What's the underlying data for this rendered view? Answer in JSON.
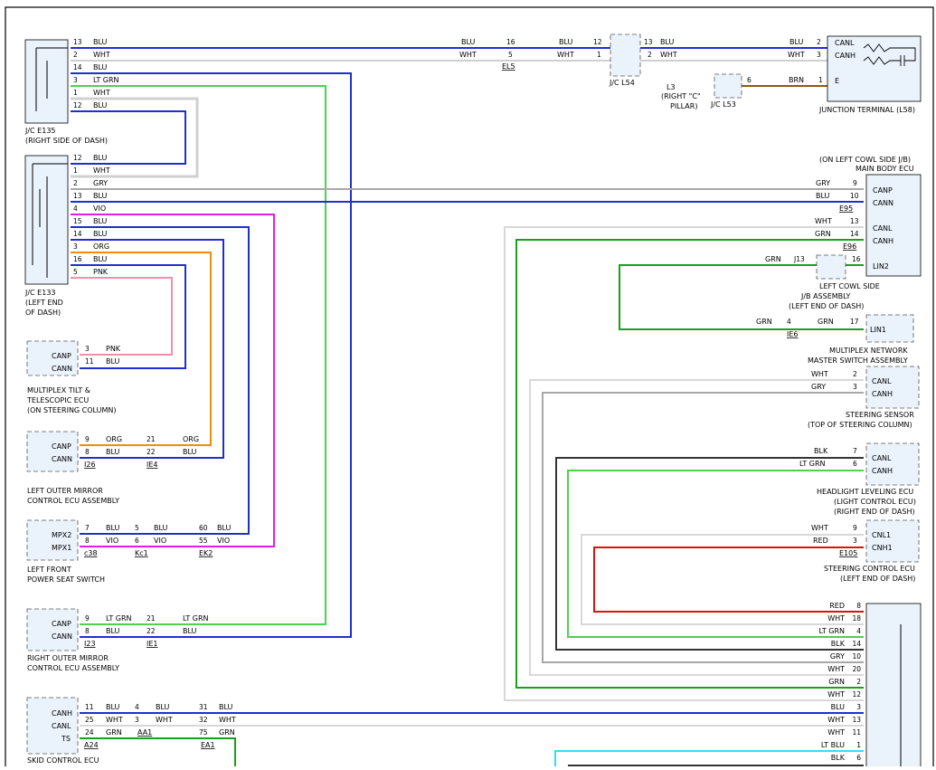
{
  "colors": {
    "BLU": "#1f2fcf",
    "WHT": "#cfcfcf",
    "LT GRN": "#4fd04f",
    "GRN": "#1aa01a",
    "GRY": "#a8a8a8",
    "VIO": "#e020e0",
    "ORG": "#f08c10",
    "PNK": "#f090a8",
    "BRN": "#8a5a10",
    "BLK": "#333333",
    "RED": "#e01010",
    "LT BLU": "#30e0f0"
  },
  "components": {
    "jc_e135": [
      "J/C E135",
      "(RIGHT SIDE OF DASH)"
    ],
    "jc_e133": [
      "J/C E133",
      "(LEFT END",
      "OF DASH)"
    ],
    "jc_l54": "J/C L54",
    "jc_l53": "J/C L53",
    "l3": [
      "L3",
      "(RIGHT \"C\"",
      "PILLAR)"
    ],
    "junction_terminal": "JUNCTION TERMINAL (L58)",
    "main_body_ecu": [
      "(ON LEFT COWL SIDE J/B)",
      "MAIN BODY ECU"
    ],
    "cowl_jb": [
      "LEFT COWL SIDE",
      "J/B ASSEMBLY",
      "(LEFT END OF DASH)"
    ],
    "multiplex_switch": [
      "MULTIPLEX NETWORK",
      "MASTER SWITCH ASSEMBLY"
    ],
    "steering_sensor": [
      "STEERING SENSOR",
      "(TOP OF STEERING COLUMN)"
    ],
    "headlight_ecu": [
      "HEADLIGHT LEVELING ECU",
      "(LIGHT CONTROL ECU)",
      "(RIGHT END OF DASH)"
    ],
    "steering_ecu": [
      "STEERING CONTROL ECU",
      "(LEFT END OF DASH)"
    ],
    "tilt_ecu": [
      "MULTIPLEX TILT &",
      "TELESCOPIC ECU",
      "(ON STEERING COLUMN)"
    ],
    "left_mirror": [
      "LEFT OUTER MIRROR",
      "CONTROL ECU ASSEMBLY"
    ],
    "left_seat": [
      "LEFT FRONT",
      "POWER SEAT SWITCH"
    ],
    "right_mirror": [
      "RIGHT OUTER MIRROR",
      "CONTROL ECU ASSEMBLY"
    ],
    "skid_ecu": "SKID CONTROL ECU"
  },
  "e135_pins": [
    {
      "pin": "13",
      "color": "BLU"
    },
    {
      "pin": "2",
      "color": "WHT"
    },
    {
      "pin": "14",
      "color": "BLU"
    },
    {
      "pin": "3",
      "color": "LT GRN"
    },
    {
      "pin": "1",
      "color": "WHT"
    },
    {
      "pin": "12",
      "color": "BLU"
    }
  ],
  "e133_pins": [
    {
      "pin": "12",
      "color": "BLU"
    },
    {
      "pin": "1",
      "color": "WHT"
    },
    {
      "pin": "2",
      "color": "GRY"
    },
    {
      "pin": "13",
      "color": "BLU"
    },
    {
      "pin": "4",
      "color": "VIO"
    },
    {
      "pin": "15",
      "color": "BLU"
    },
    {
      "pin": "14",
      "color": "BLU"
    },
    {
      "pin": "3",
      "color": "ORG"
    },
    {
      "pin": "16",
      "color": "BLU"
    },
    {
      "pin": "5",
      "color": "PNK"
    }
  ],
  "terms": {
    "canl": "CANL",
    "canh": "CANH",
    "canp": "CANP",
    "cann": "CANN",
    "e": "E",
    "lin1": "LIN1",
    "lin2": "LIN2",
    "cnl1": "CNL1",
    "cnh1": "CNH1",
    "mpx1": "MPX1",
    "mpx2": "MPX2",
    "ts": "TS"
  },
  "conn": {
    "el5": "EL5",
    "e95": "E95",
    "e96": "E96",
    "ie6": "IE6",
    "e105": "E105",
    "i26": "I26",
    "ie4": "IE4",
    "c38": "c38",
    "kc1": "Kc1",
    "ek2": "EK2",
    "i23": "I23",
    "ie1": "IE1",
    "a24": "A24",
    "aa1": "AA1",
    "ea1": "EA1",
    "j13": "J13"
  },
  "joint_right_pins": [
    {
      "pin": "8",
      "color": "RED"
    },
    {
      "pin": "18",
      "color": "WHT"
    },
    {
      "pin": "4",
      "color": "LT GRN"
    },
    {
      "pin": "14",
      "color": "BLK"
    },
    {
      "pin": "10",
      "color": "GRY"
    },
    {
      "pin": "20",
      "color": "WHT"
    },
    {
      "pin": "2",
      "color": "GRN"
    },
    {
      "pin": "12",
      "color": "WHT"
    },
    {
      "pin": "3",
      "color": "BLU"
    },
    {
      "pin": "13",
      "color": "WHT"
    },
    {
      "pin": "11",
      "color": "WHT"
    },
    {
      "pin": "1",
      "color": "LT BLU"
    },
    {
      "pin": "6",
      "color": "BLK"
    }
  ]
}
